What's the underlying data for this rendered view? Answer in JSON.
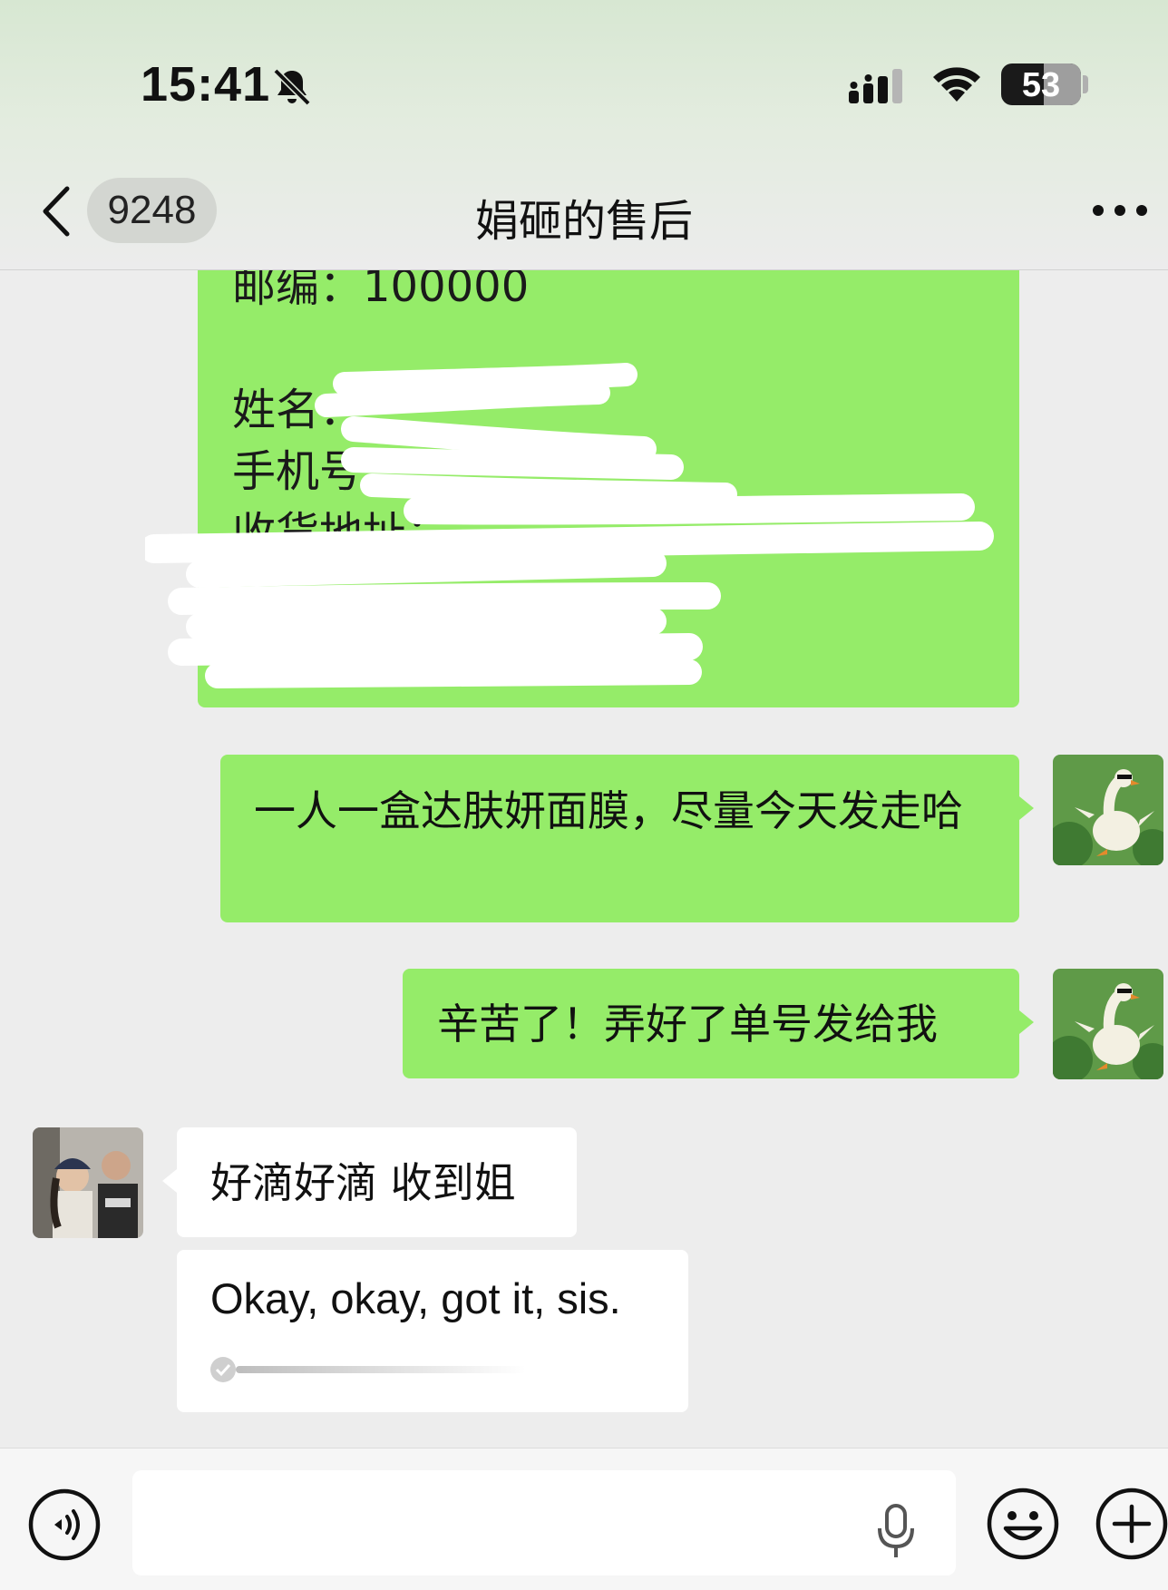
{
  "status_bar": {
    "time": "15:41",
    "battery_percent": "53",
    "icons": [
      "bell-slash-icon",
      "cellular-signal-icon",
      "wifi-icon",
      "battery-icon"
    ]
  },
  "nav": {
    "unread_count": "9248",
    "title": "娟砸的售后",
    "icons": [
      "chevron-left-icon",
      "more-icon"
    ]
  },
  "messages": [
    {
      "side": "right",
      "lines": [
        "邮编：100000",
        "姓名：",
        "手机号：",
        "收货地址：",
        "",
        ""
      ],
      "redacted": true
    },
    {
      "side": "right",
      "text": "一人一盒达肤妍面膜，尽量今天发走哈"
    },
    {
      "side": "right",
      "text": "辛苦了！弄好了单号发给我"
    },
    {
      "side": "left",
      "text": "好滴好滴 收到姐"
    },
    {
      "side": "left",
      "translation": "Okay, okay, got it, sis."
    }
  ],
  "input_bar": {
    "placeholder": "",
    "icons": [
      "voice-icon",
      "microphone-icon",
      "emoji-icon",
      "plus-icon"
    ]
  },
  "colors": {
    "sent_bubble": "#95ec69",
    "received_bubble": "#ffffff",
    "background": "#ededed"
  }
}
